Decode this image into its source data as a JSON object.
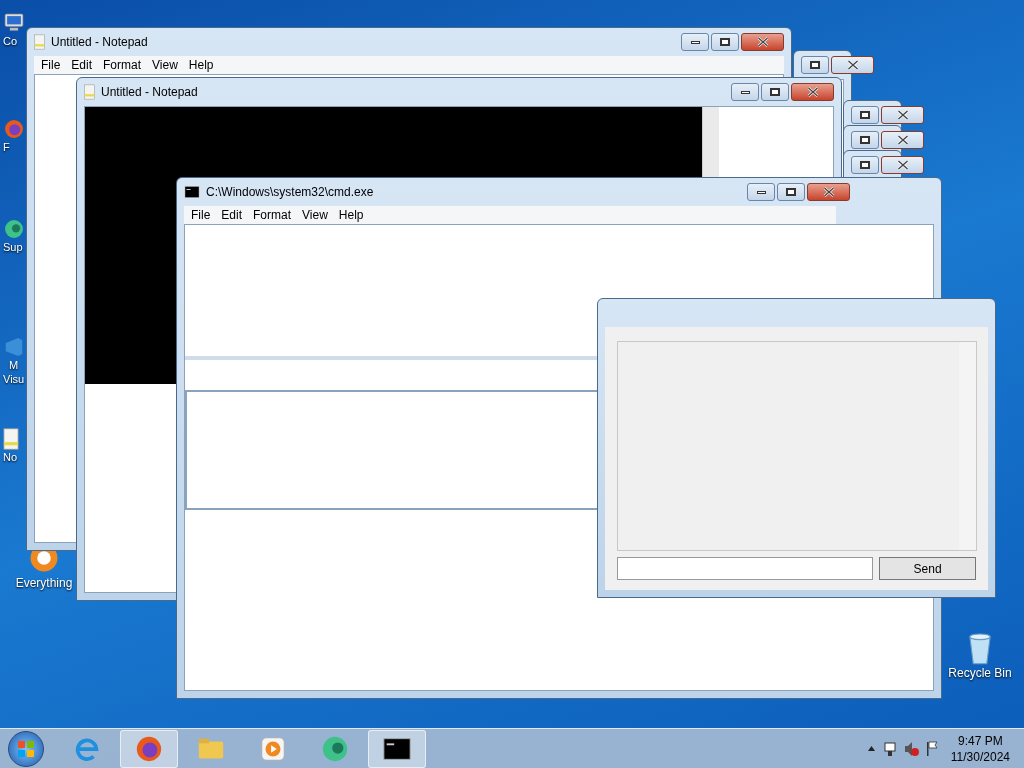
{
  "desktop_icons": [
    {
      "kind": "computer",
      "lines": [
        "Co"
      ]
    },
    {
      "kind": "firefox",
      "lines": [
        "F"
      ]
    },
    {
      "kind": "green",
      "lines": [
        "Sup"
      ]
    },
    {
      "kind": "vs",
      "lines": [
        "M",
        "Visu"
      ]
    },
    {
      "kind": "notepad",
      "lines": [
        "No"
      ]
    },
    {
      "kind": "everything",
      "lines": [
        "Everything"
      ]
    },
    {
      "kind": "bin",
      "lines": [
        "Recycle Bin"
      ]
    }
  ],
  "windows": [
    {
      "title": "Untitled - Notepad",
      "menu": [
        "File",
        "Edit",
        "Format",
        "View",
        "Help"
      ]
    },
    {
      "title": "Untitled - Notepad"
    },
    {
      "title": "C:\\Windows\\system32\\cmd.exe",
      "menu": [
        "File",
        "Edit",
        "Format",
        "View",
        "Help"
      ]
    }
  ],
  "dialog": {
    "button": "Send"
  },
  "taskbar": {
    "apps": [
      {
        "kind": "ie",
        "selected": false
      },
      {
        "kind": "firefox",
        "selected": true
      },
      {
        "kind": "folder",
        "selected": false
      },
      {
        "kind": "media",
        "selected": false
      },
      {
        "kind": "green",
        "selected": false
      },
      {
        "kind": "cmd",
        "selected": true
      }
    ],
    "clock": {
      "time": "9:47 PM",
      "date": "11/30/2024"
    }
  }
}
